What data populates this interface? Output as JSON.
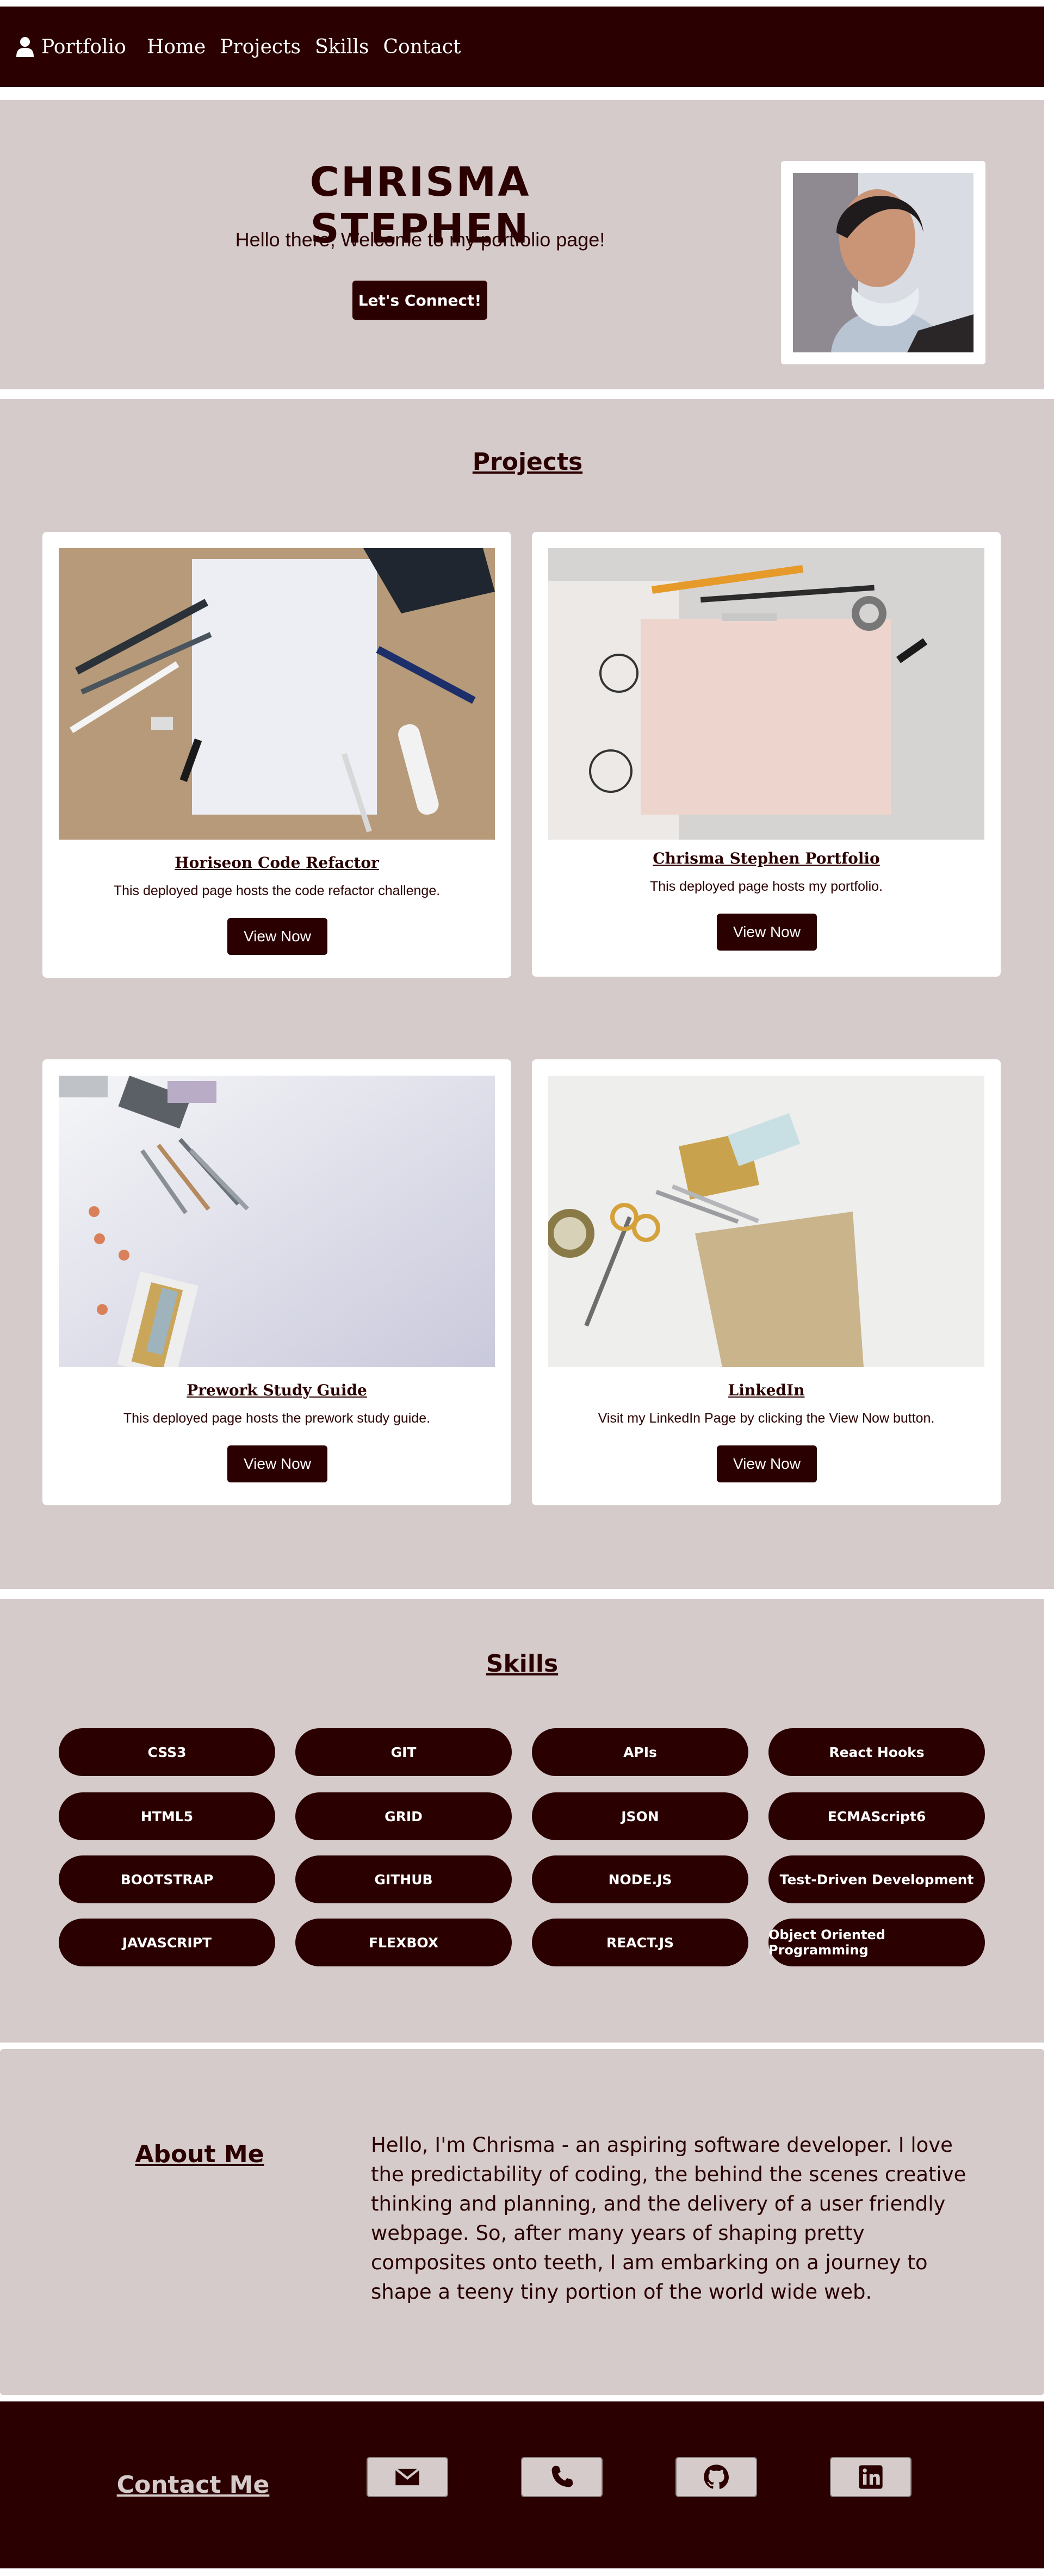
{
  "nav": {
    "brand": "Portfolio",
    "links": [
      "Home",
      "Projects",
      "Skills",
      "Contact"
    ]
  },
  "hero": {
    "name": "CHRISMA STEPHEN",
    "welcome": "Hello there, Welcome to my portfolio page!",
    "cta": "Let's Connect!"
  },
  "projects": {
    "title": "Projects",
    "items": [
      {
        "title": "Horiseon Code Refactor",
        "desc": "This deployed page hosts the code refactor challenge.",
        "button": "View Now"
      },
      {
        "title": "Chrisma Stephen Portfolio",
        "desc": "This deployed page hosts my portfolio.",
        "button": "View Now"
      },
      {
        "title": "Prework Study Guide",
        "desc": "This deployed page hosts the prework study guide.",
        "button": "View Now"
      },
      {
        "title": "LinkedIn",
        "desc": "Visit my LinkedIn Page by clicking the View Now button.",
        "button": "View Now"
      }
    ]
  },
  "skills": {
    "title": "Skills",
    "items": [
      "CSS3",
      "GIT",
      "APIs",
      "React Hooks",
      "HTML5",
      "GRID",
      "JSON",
      "ECMAScript6",
      "BOOTSTRAP",
      "GITHUB",
      "NODE.JS",
      "Test-Driven Development",
      "JAVASCRIPT",
      "FLEXBOX",
      "REACT.JS",
      "Object Oriented Programming"
    ]
  },
  "about": {
    "title": "About Me",
    "body": "Hello, I'm Chrisma - an aspiring software developer. I love the predictability of coding, the behind the scenes creative thinking and planning, and the delivery of a user friendly webpage. So, after many years of shaping pretty composites onto teeth, I am embarking on a journey to shape a teeny tiny portion of the world wide web."
  },
  "contact": {
    "title": "Contact Me",
    "icons": [
      "envelope-icon",
      "phone-icon",
      "github-icon",
      "linkedin-icon"
    ]
  },
  "colors": {
    "primary": "#2b0000",
    "background": "#d5cbcb",
    "white": "#ffffff"
  }
}
